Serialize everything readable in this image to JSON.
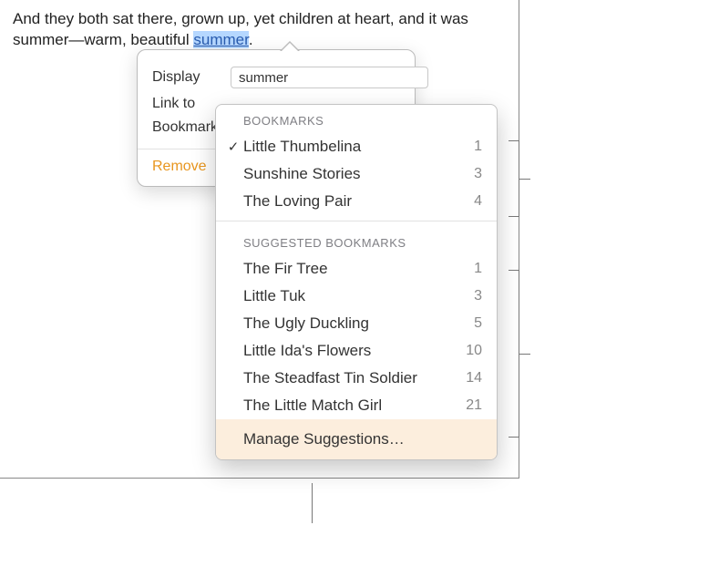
{
  "body_text_prefix": "And they both sat there, grown up, yet children at heart, and it was summer—warm, beautiful ",
  "body_text_link": "summer",
  "body_text_suffix": ".",
  "popover": {
    "display_label": "Display",
    "display_value": "summer",
    "linkto_label": "Link to",
    "bookmark_label": "Bookmark",
    "remove_label": "Remove"
  },
  "dropdown": {
    "bookmarks_header": "BOOKMARKS",
    "bookmarks": [
      {
        "name": "Little Thumbelina",
        "num": "1",
        "checked": true
      },
      {
        "name": "Sunshine Stories",
        "num": "3",
        "checked": false
      },
      {
        "name": "The Loving Pair",
        "num": "4",
        "checked": false
      }
    ],
    "suggested_header": "SUGGESTED BOOKMARKS",
    "suggested": [
      {
        "name": "The Fir Tree",
        "num": "1"
      },
      {
        "name": "Little Tuk",
        "num": "3"
      },
      {
        "name": "The Ugly Duckling",
        "num": "5"
      },
      {
        "name": "Little Ida's Flowers",
        "num": "10"
      },
      {
        "name": "The Steadfast Tin Soldier",
        "num": "14"
      },
      {
        "name": "The Little Match Girl",
        "num": "21"
      }
    ],
    "manage_label": "Manage Suggestions…"
  }
}
